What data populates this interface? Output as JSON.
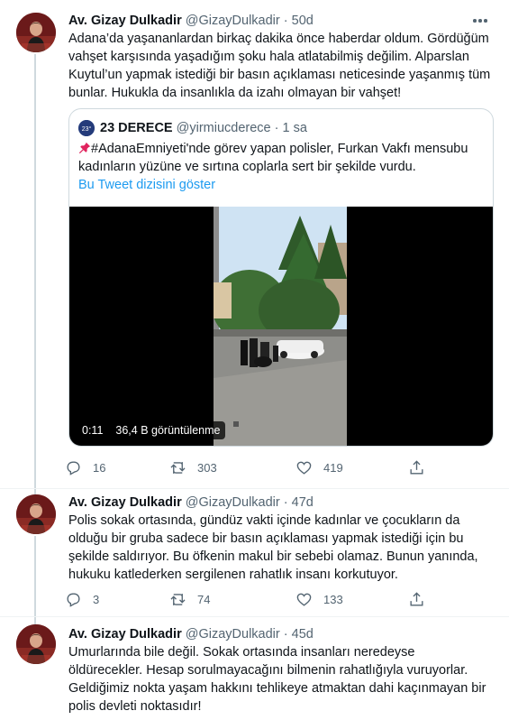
{
  "tweets": [
    {
      "name": "Av. Gizay Dulkadir",
      "handle": "@GizayDulkadir",
      "time": "50d",
      "text": "Adana’da yaşananlardan birkaç dakika önce haberdar oldum. Gördüğüm vahşet karşısında yaşadığım şoku hala atlatabilmiş değilim. Alparslan Kuytul’un yapmak istediği bir basın açıklaması neticesinde yaşanmış tüm bunlar. Hukukla da insanlıkla da izahı olmayan bir vahşet!",
      "quote": {
        "name": "23 DERECE",
        "handle": "@yirmiucderece",
        "time": "1 sa",
        "text": "#AdanaEmniyeti'nde görev yapan polisler, Furkan Vakfı mensubu kadınların yüzüne ve sırtına coplarla sert bir şekilde vurdu.",
        "thread_link": "Bu Tweet dizisini göster",
        "video_duration": "0:11",
        "video_views": "36,4 B görüntülenme"
      },
      "replies": "16",
      "retweets": "303",
      "likes": "419"
    },
    {
      "name": "Av. Gizay Dulkadir",
      "handle": "@GizayDulkadir",
      "time": "47d",
      "text": "Polis sokak ortasında, gündüz vakti içinde kadınlar ve çocukların da olduğu bir gruba sadece bir basın açıklaması yapmak istediği için bu şekilde saldırıyor. Bu öfkenin makul bir sebebi olamaz. Bunun yanında, hukuku katlederken sergilenen rahatlık insanı korkutuyor.",
      "replies": "3",
      "retweets": "74",
      "likes": "133"
    },
    {
      "name": "Av. Gizay Dulkadir",
      "handle": "@GizayDulkadir",
      "time": "45d",
      "text": "Umurlarında bile değil. Sokak ortasında insanları neredeyse öldürecekler. Hesap sorulmayacağını bilmenin rahatlığıyla vuruyorlar. Geldiğimiz nokta yaşam hakkını tehlikeye atmaktan dahi kaçınmayan bir polis devleti noktasıdır!"
    }
  ],
  "colors": {
    "text": "#0f1419",
    "secondary": "#536471",
    "link": "#1d9bf0",
    "border": "#cfd9de"
  },
  "icons": [
    "more-icon",
    "reply-icon",
    "retweet-icon",
    "like-icon",
    "share-icon",
    "pushpin-icon"
  ]
}
